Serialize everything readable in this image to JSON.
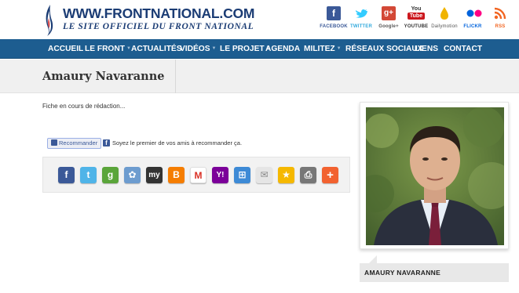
{
  "site": {
    "title": "WWW.FRONTNATIONAL.COM",
    "tagline": "LE SITE OFFICIEL DU FRONT NATIONAL"
  },
  "social": [
    {
      "label": "FACEBOOK",
      "icon": "facebook-icon",
      "glyph": "f",
      "color": "#3b5998",
      "label_color": "#3b5998"
    },
    {
      "label": "TWITTER",
      "icon": "twitter-icon",
      "glyph": "t",
      "color": "#33ccff",
      "label_color": "#33aadd"
    },
    {
      "label": "Google+",
      "icon": "googleplus-icon",
      "glyph": "g+",
      "color": "#d34836",
      "label_color": "#555555"
    },
    {
      "label": "YOUTUBE",
      "icon": "youtube-icon",
      "glyph": "You",
      "color": "#cc181e",
      "label_color": "#333333"
    },
    {
      "label": "Dailymotion",
      "icon": "dailymotion-icon",
      "glyph": "",
      "color": "#f0b400",
      "label_color": "#555555"
    },
    {
      "label": "FLICKR",
      "icon": "flickr-icon",
      "glyph": "",
      "color": "#ff0084",
      "label_color": "#0063dc"
    },
    {
      "label": "RSS",
      "icon": "rss-icon",
      "glyph": ")",
      "color": "#f26522",
      "label_color": "#f26522"
    }
  ],
  "nav": {
    "items": [
      {
        "label": "ACCUEIL",
        "caret": false
      },
      {
        "label": "LE FRONT",
        "caret": true
      },
      {
        "label": "ACTUALITÉS",
        "caret": false
      },
      {
        "label": "VIDÉOS",
        "caret": true
      },
      {
        "label": "LE PROJET",
        "caret": true
      },
      {
        "label": "AGENDA",
        "caret": false
      },
      {
        "label": "MILITEZ",
        "caret": true
      },
      {
        "label": "RÉSEAUX SOCIAUX",
        "caret": false
      },
      {
        "label": "LIENS",
        "caret": false
      },
      {
        "label": "CONTACT",
        "caret": false
      }
    ]
  },
  "page": {
    "title": "Amaury Navaranne",
    "intro": "Fiche en cours de rédaction..."
  },
  "recommend": {
    "button_label": "Recommander",
    "text": "Soyez le premier de vos amis à recommander ça."
  },
  "share_icons": [
    {
      "name": "facebook",
      "glyph": "f",
      "color": "#3b5998"
    },
    {
      "name": "twitter",
      "glyph": "t",
      "color": "#4fb4e8"
    },
    {
      "name": "google-bookmarks",
      "glyph": "g",
      "color": "#5aa53a"
    },
    {
      "name": "delicious",
      "glyph": "✿",
      "color": "#6d9ccf"
    },
    {
      "name": "myspace",
      "glyph": "my",
      "color": "#333333"
    },
    {
      "name": "blogger",
      "glyph": "B",
      "color": "#f57d00"
    },
    {
      "name": "gmail",
      "glyph": "M",
      "color": "#ffffff"
    },
    {
      "name": "yahoo",
      "glyph": "Y!",
      "color": "#7b0099"
    },
    {
      "name": "windows-live",
      "glyph": "⊞",
      "color": "#3d8ad6"
    },
    {
      "name": "email",
      "glyph": "✉",
      "color": "#e5e5e5"
    },
    {
      "name": "favorites",
      "glyph": "★",
      "color": "#f5b800"
    },
    {
      "name": "print",
      "glyph": "⎙",
      "color": "#777777"
    },
    {
      "name": "more",
      "glyph": "+",
      "color": "#f26230"
    }
  ],
  "sidebar": {
    "caption": "AMAURY NAVARANNE"
  }
}
